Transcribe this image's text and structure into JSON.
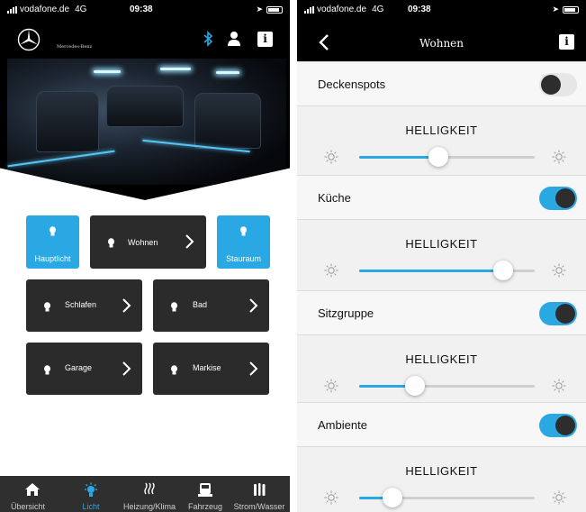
{
  "left": {
    "status": {
      "carrier": "vodafone.de",
      "network": "4G",
      "time": "09:38"
    },
    "brand_text": "Mercedes-Benz",
    "header_icons": [
      "bluetooth-icon",
      "person-icon",
      "info-icon"
    ],
    "info_label": "i",
    "tiles": [
      {
        "label": "Hauptlicht",
        "style": "blue",
        "icon": "bulb-icon"
      },
      {
        "label": "Wohnen",
        "style": "dark",
        "icon": "bulb-icon",
        "chevron": true
      },
      {
        "label": "Stauraum",
        "style": "blue",
        "icon": "bulb-icon"
      },
      {
        "label": "Schlafen",
        "style": "dark",
        "icon": "bulb-icon",
        "chevron": true
      },
      {
        "label": "Bad",
        "style": "dark",
        "icon": "bulb-icon",
        "chevron": true
      },
      {
        "label": "Garage",
        "style": "dark",
        "icon": "bulb-icon",
        "chevron": true
      },
      {
        "label": "Markise",
        "style": "dark",
        "icon": "bulb-icon",
        "chevron": true
      }
    ],
    "tabs": [
      {
        "label": "Übersicht",
        "icon": "home-icon",
        "active": false
      },
      {
        "label": "Licht",
        "icon": "light-icon",
        "active": true
      },
      {
        "label": "Heizung/Klima",
        "icon": "heat-icon",
        "active": false
      },
      {
        "label": "Fahrzeug",
        "icon": "vehicle-icon",
        "active": false
      },
      {
        "label": "Strom/Wasser",
        "icon": "power-water-icon",
        "active": false
      }
    ]
  },
  "right": {
    "status": {
      "carrier": "vodafone.de",
      "network": "4G",
      "time": "09:38"
    },
    "title": "Wohnen",
    "info_label": "i",
    "brightness_label": "HELLIGKEIT",
    "lights": [
      {
        "name": "Deckenspots",
        "on": false,
        "brightness": 0.45
      },
      {
        "name": "Küche",
        "on": true,
        "brightness": 0.82
      },
      {
        "name": "Sitzgruppe",
        "on": true,
        "brightness": 0.32
      },
      {
        "name": "Ambiente",
        "on": true,
        "brightness": 0.19
      }
    ]
  },
  "colors": {
    "accent": "#2aa8e4",
    "tile_dark": "#2b2b2b",
    "tabbar": "#2f2f2f",
    "header": "#000000"
  }
}
